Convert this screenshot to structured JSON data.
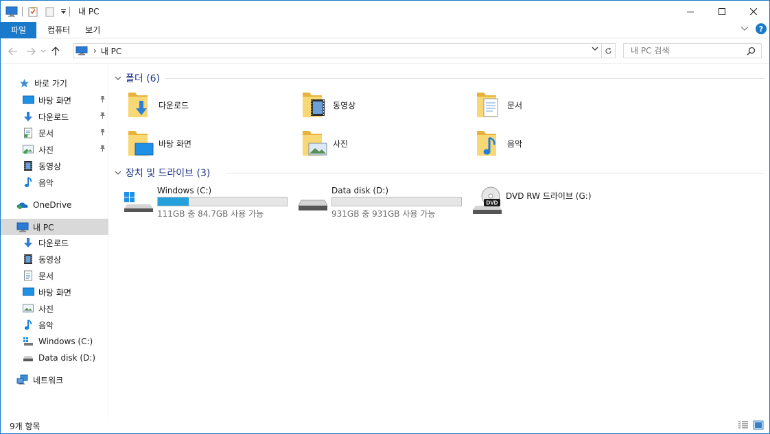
{
  "window": {
    "title": "내 PC"
  },
  "ribbon": {
    "tabs": [
      "파일",
      "컴퓨터",
      "보기"
    ]
  },
  "address": {
    "crumb": "내 PC",
    "search_placeholder": "내 PC 검색"
  },
  "sidebar": {
    "quick_access_label": "바로 가기",
    "quick_items": [
      {
        "label": "바탕 화면",
        "icon": "desktop-icon",
        "pinned": true
      },
      {
        "label": "다운로드",
        "icon": "download-icon",
        "pinned": true
      },
      {
        "label": "문서",
        "icon": "documents-icon",
        "pinned": true
      },
      {
        "label": "사진",
        "icon": "pictures-icon",
        "pinned": true
      },
      {
        "label": "동영상",
        "icon": "videos-icon",
        "pinned": false
      },
      {
        "label": "음악",
        "icon": "music-icon",
        "pinned": false
      }
    ],
    "onedrive_label": "OneDrive",
    "thispc_label": "내 PC",
    "pc_items": [
      {
        "label": "다운로드",
        "icon": "download-icon"
      },
      {
        "label": "동영상",
        "icon": "videos-icon"
      },
      {
        "label": "문서",
        "icon": "documents-icon"
      },
      {
        "label": "바탕 화면",
        "icon": "desktop-icon"
      },
      {
        "label": "사진",
        "icon": "pictures-icon"
      },
      {
        "label": "음악",
        "icon": "music-icon"
      },
      {
        "label": "Windows (C:)",
        "icon": "windows-drive-icon"
      },
      {
        "label": "Data disk (D:)",
        "icon": "drive-icon"
      }
    ],
    "network_label": "네트워크"
  },
  "folders": {
    "header": "폴더 (6)",
    "items": [
      {
        "label": "다운로드",
        "icon": "download-folder-icon"
      },
      {
        "label": "동영상",
        "icon": "videos-folder-icon"
      },
      {
        "label": "문서",
        "icon": "documents-folder-icon"
      },
      {
        "label": "바탕 화면",
        "icon": "desktop-folder-icon"
      },
      {
        "label": "사진",
        "icon": "pictures-folder-icon"
      },
      {
        "label": "음악",
        "icon": "music-folder-icon"
      }
    ]
  },
  "drives": {
    "header": "장치 및 드라이브 (3)",
    "items": [
      {
        "name": "Windows (C:)",
        "free": "111GB 중 84.7GB 사용 가능",
        "used_fraction": 0.24,
        "icon": "windows-drive-icon"
      },
      {
        "name": "Data disk (D:)",
        "free": "931GB 중 931GB 사용 가능",
        "used_fraction": 0.0,
        "icon": "drive-icon"
      },
      {
        "name": "DVD RW 드라이브 (G:)",
        "icon": "dvd-drive-icon"
      }
    ]
  },
  "status": {
    "item_count": "9개 항목"
  },
  "colors": {
    "accent": "#1979ca",
    "bar_fill": "#26a0da",
    "folder": "#f5c842",
    "group_header": "#1e3287"
  }
}
